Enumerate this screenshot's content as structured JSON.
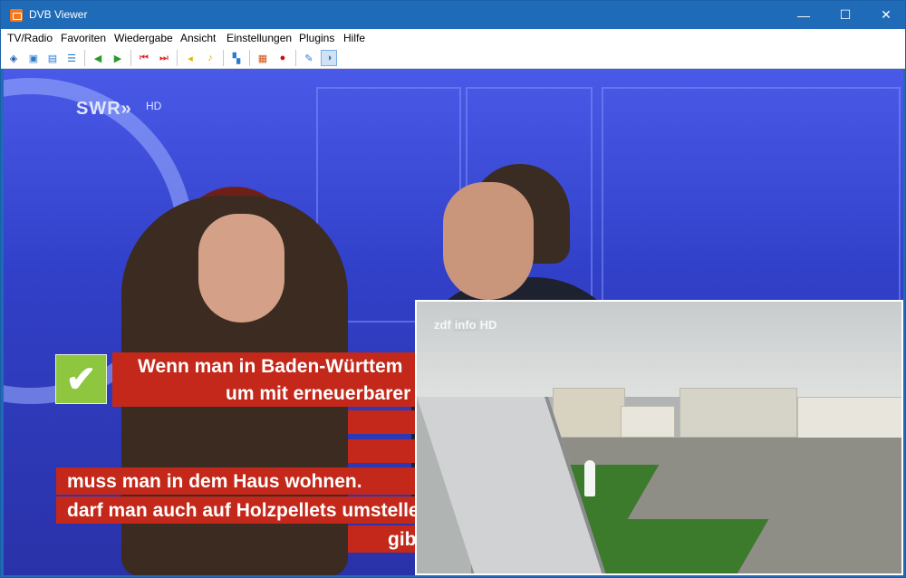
{
  "window": {
    "title": "DVB Viewer",
    "controls": {
      "minimize": "—",
      "maximize": "☐",
      "close": "✕"
    }
  },
  "menu": [
    "TV/Radio",
    "Favoriten",
    "Wiedergabe",
    "Ansicht",
    "Einstellungen",
    "Plugins",
    "Hilfe"
  ],
  "toolbar": {
    "buttons": [
      {
        "name": "settings-icon",
        "glyph": "◈",
        "color": "#1e5aa8"
      },
      {
        "name": "channel-icon",
        "glyph": "▣",
        "color": "#2b7bd0"
      },
      {
        "name": "window-icon",
        "glyph": "▤",
        "color": "#2b7bd0"
      },
      {
        "name": "epg-icon",
        "glyph": "☰",
        "color": "#2b7bd0"
      },
      {
        "name": "back-icon",
        "glyph": "◀",
        "color": "#2a9a2a"
      },
      {
        "name": "forward-icon",
        "glyph": "▶",
        "color": "#2a9a2a"
      },
      {
        "name": "prev-channel-icon",
        "glyph": "⏮",
        "color": "#e02020"
      },
      {
        "name": "next-channel-icon",
        "glyph": "⏭",
        "color": "#e02020"
      },
      {
        "name": "volume-down-icon",
        "glyph": "◂",
        "color": "#e8b000"
      },
      {
        "name": "volume-up-icon",
        "glyph": "♪",
        "color": "#e8b000"
      },
      {
        "name": "picture-in-picture-icon",
        "glyph": "▚",
        "color": "#2b7bd0"
      },
      {
        "name": "snapshot-icon",
        "glyph": "▦",
        "color": "#d05010"
      },
      {
        "name": "record-icon",
        "glyph": "●",
        "color": "#c01010"
      },
      {
        "name": "teletext-icon",
        "glyph": "✎",
        "color": "#2b7bd0"
      },
      {
        "name": "timeshift-icon",
        "glyph": "◑",
        "color": "#607090"
      }
    ]
  },
  "video": {
    "channel_logo": "SWR»",
    "channel_hd": "HD",
    "checkmark": "✔",
    "subtitles": [
      "Wenn man in Baden-Württem",
      "um mit erneuerbarer",
      "muss man in dem Haus wohnen.",
      "darf man auch auf Holzpellets umsteller",
      "gib"
    ],
    "pip_logo_main": "zdf",
    "pip_logo_mid": "info",
    "pip_logo_end": "HD"
  }
}
